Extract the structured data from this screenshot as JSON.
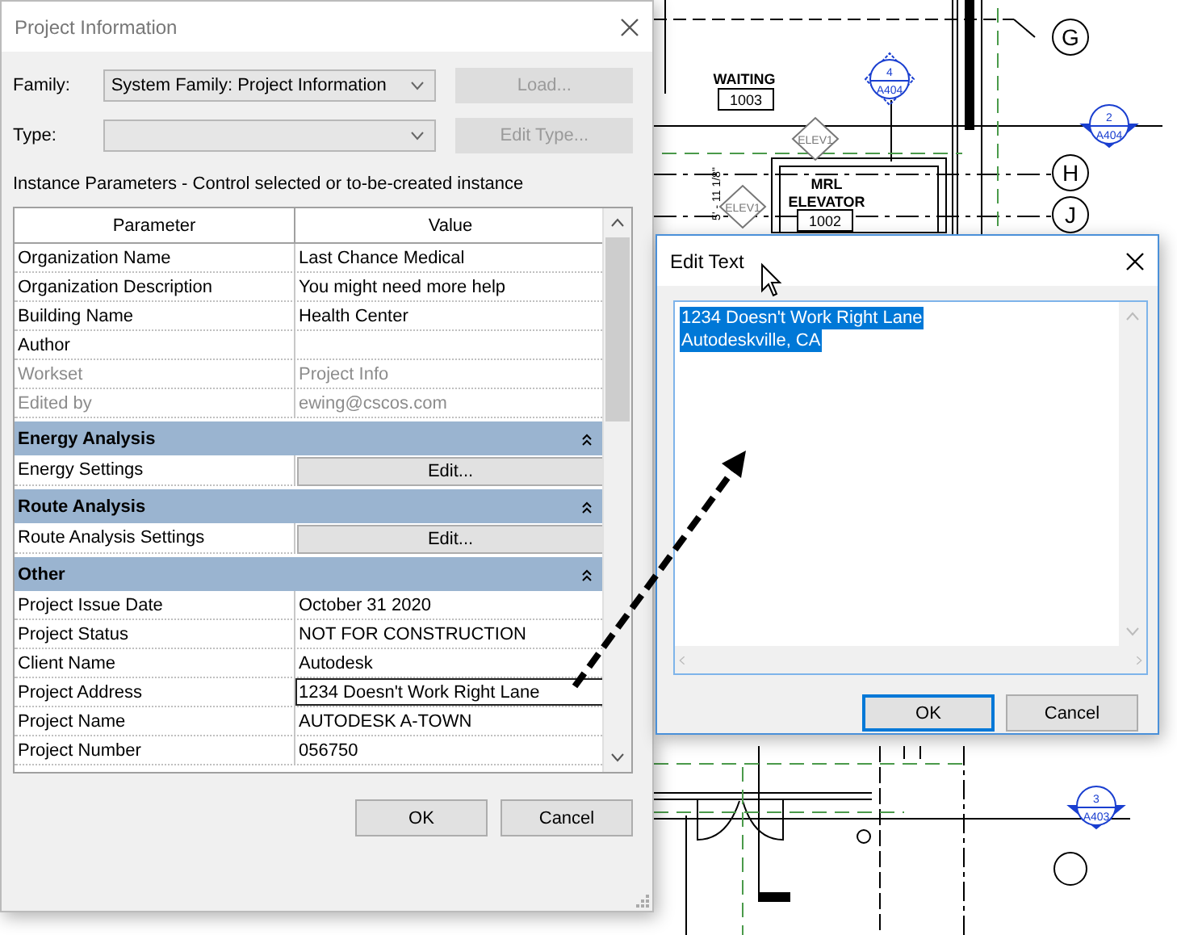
{
  "plan": {
    "rooms": [
      {
        "name_lines": [
          "WAITING"
        ],
        "number": "1003"
      },
      {
        "name_lines": [
          "MRL",
          "ELEVATOR"
        ],
        "number": "1002"
      }
    ],
    "grid_bubbles": [
      "G",
      "H",
      "J"
    ],
    "section_marks": [
      {
        "number": "4",
        "sheet": "A404"
      },
      {
        "number": "2",
        "sheet": "A404"
      },
      {
        "number": "3",
        "sheet": "A403"
      }
    ],
    "elevation_tags": [
      "ELEV1",
      "ELEV1"
    ],
    "dimension": "5' - 11 1/8\""
  },
  "project_information": {
    "title": "Project Information",
    "family": {
      "label": "Family:",
      "value": "System Family: Project Information"
    },
    "type": {
      "label": "Type:"
    },
    "side_buttons": [
      {
        "label": "Load...",
        "disabled": true
      },
      {
        "label": "Edit Type...",
        "disabled": true
      }
    ],
    "caption": "Instance Parameters - Control selected or to-be-created instance",
    "table": {
      "columns": [
        "Parameter",
        "Value"
      ],
      "rows": [
        {
          "kind": "param",
          "name": "Organization Name",
          "value": "Last Chance Medical",
          "disabled": false,
          "editing": false
        },
        {
          "kind": "param",
          "name": "Organization Description",
          "value": "You might need more help",
          "disabled": false,
          "editing": false
        },
        {
          "kind": "param",
          "name": "Building Name",
          "value": "Health Center",
          "disabled": false,
          "editing": false
        },
        {
          "kind": "param",
          "name": "Author",
          "disabled": false,
          "editing": false
        },
        {
          "kind": "param",
          "name": "Workset",
          "value": "Project Info",
          "disabled": true,
          "editing": false
        },
        {
          "kind": "param",
          "name": "Edited by",
          "value": "ewing@cscos.com",
          "disabled": true,
          "editing": false
        },
        {
          "kind": "group",
          "label": "Energy Analysis",
          "expanded": true
        },
        {
          "kind": "button",
          "name": "Energy Settings",
          "button": "Edit..."
        },
        {
          "kind": "group",
          "label": "Route Analysis",
          "expanded": true
        },
        {
          "kind": "button",
          "name": "Route Analysis Settings",
          "button": "Edit..."
        },
        {
          "kind": "group",
          "label": "Other",
          "expanded": true
        },
        {
          "kind": "param",
          "name": "Project Issue Date",
          "value": "October 31 2020",
          "disabled": false,
          "editing": false
        },
        {
          "kind": "param",
          "name": "Project Status",
          "value": "NOT FOR CONSTRUCTION",
          "disabled": false,
          "editing": false
        },
        {
          "kind": "param",
          "name": "Client Name",
          "value": "Autodesk",
          "disabled": false,
          "editing": false
        },
        {
          "kind": "param",
          "name": "Project Address",
          "value": "1234 Doesn't Work Right Lane",
          "disabled": false,
          "editing": true
        },
        {
          "kind": "param",
          "name": "Project Name",
          "value": "AUTODESK A-TOWN",
          "disabled": false,
          "editing": false
        },
        {
          "kind": "param",
          "name": "Project Number",
          "value": "056750",
          "disabled": false,
          "editing": false
        }
      ]
    },
    "buttons": [
      {
        "label": "OK",
        "default": false
      },
      {
        "label": "Cancel",
        "default": false
      }
    ]
  },
  "edit_text": {
    "title": "Edit Text",
    "lines": [
      "1234 Doesn't Work Right Lane",
      "Autodeskville, CA"
    ],
    "selected": true,
    "buttons": [
      {
        "label": "OK",
        "default": true
      },
      {
        "label": "Cancel",
        "default": false
      }
    ]
  }
}
